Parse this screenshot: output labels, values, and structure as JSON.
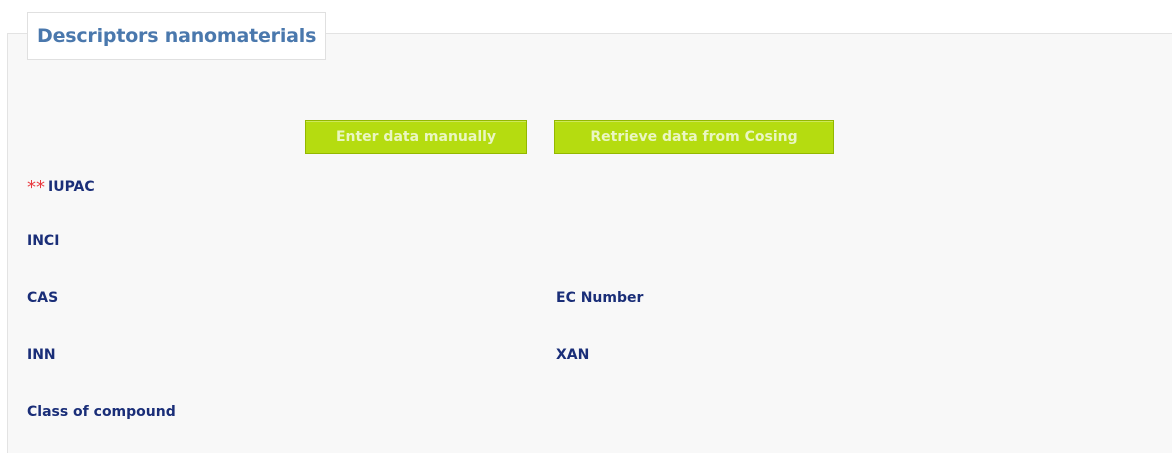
{
  "section": {
    "title": "Descriptors nanomaterials"
  },
  "actions": {
    "enter_manually": "Enter data manually",
    "retrieve_cosing": "Retrieve data from Cosing"
  },
  "fields": {
    "iupac": {
      "required_marker": "**",
      "label": "IUPAC"
    },
    "inci": {
      "label": "INCI"
    },
    "cas": {
      "label": "CAS"
    },
    "ec_number": {
      "label": "EC Number"
    },
    "inn": {
      "label": "INN"
    },
    "xan": {
      "label": "XAN"
    },
    "class_of_compound": {
      "label": "Class of compound"
    }
  },
  "colors": {
    "legend_text": "#4a78ad",
    "label_text": "#1a2e78",
    "required_marker": "#e8383d",
    "button_bg": "#b5dc10",
    "button_text": "#eaf6c2",
    "panel_bg": "#f8f8f8"
  }
}
